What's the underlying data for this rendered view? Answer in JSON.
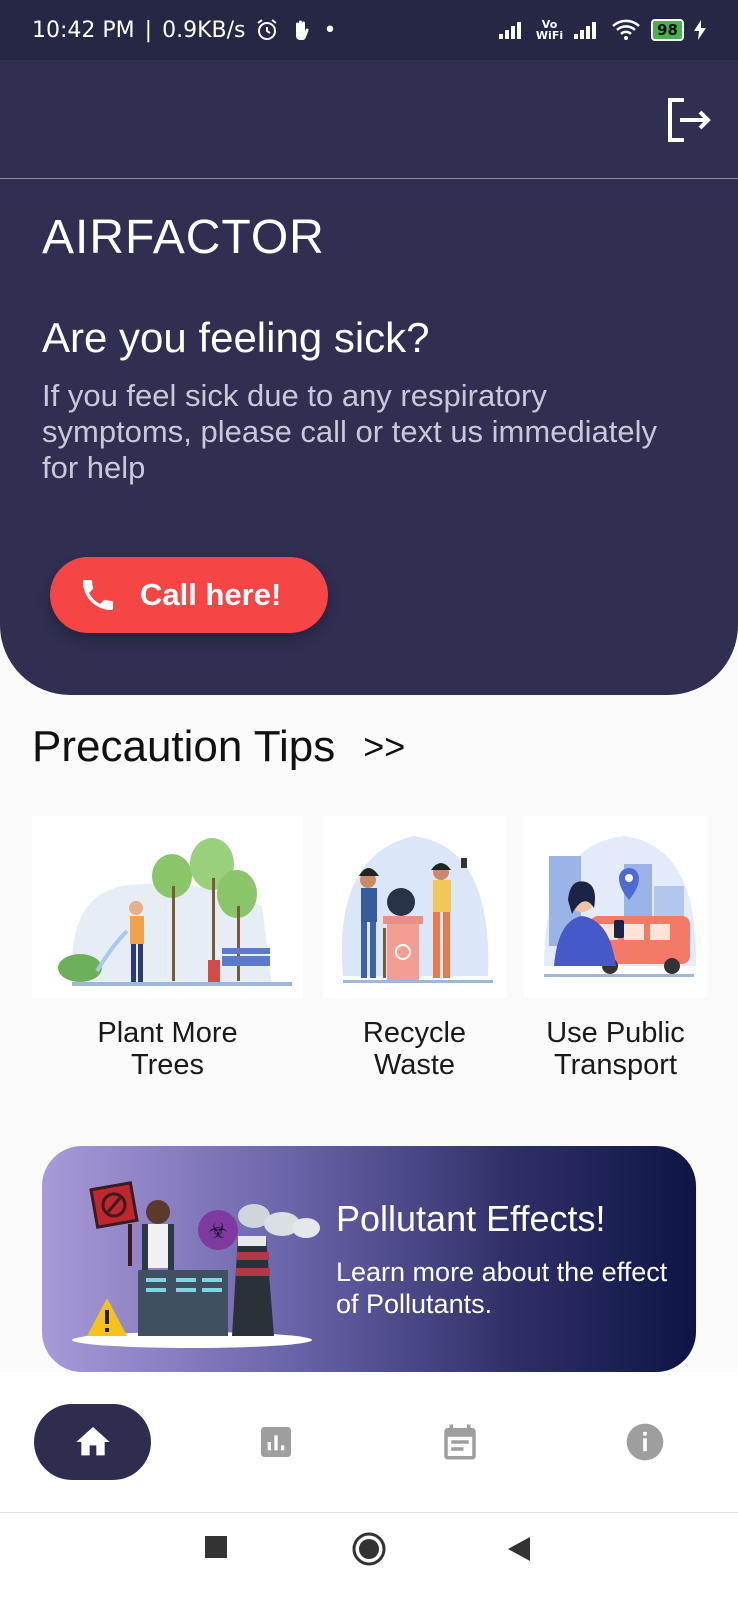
{
  "status_bar": {
    "time": "10:42 PM",
    "separator": "|",
    "net_speed": "0.9KB/s",
    "dot": "•",
    "vowifi_top": "Vo",
    "vowifi_bottom": "WiFi",
    "battery": "98"
  },
  "header": {
    "app_title": "AIRFACTOR",
    "question": "Are you feeling sick?",
    "subtext": "If you feel sick due to any respiratory symptoms, please call or text us immediately for help",
    "call_button_label": "Call here!"
  },
  "precautions": {
    "heading": "Precaution Tips",
    "more": ">>",
    "tips": [
      {
        "line1": "Plant More",
        "line2": "Trees"
      },
      {
        "line1": "Recycle",
        "line2": "Waste"
      },
      {
        "line1": "Use Public",
        "line2": "Transport"
      }
    ]
  },
  "banner": {
    "title": "Pollutant Effects!",
    "subtitle": "Learn more about the effect of Pollutants."
  },
  "bottom_nav": {
    "items": [
      {
        "icon": "home-icon",
        "active": true
      },
      {
        "icon": "chart-icon",
        "active": false
      },
      {
        "icon": "calendar-icon",
        "active": false
      },
      {
        "icon": "info-icon",
        "active": false
      }
    ]
  },
  "colors": {
    "header_bg": "#302e51",
    "status_bg": "#262745",
    "call_button": "#f64545",
    "page_bg": "#fafafa",
    "nav_active": "#2e2d50",
    "nav_inactive": "#9e9e9e"
  }
}
